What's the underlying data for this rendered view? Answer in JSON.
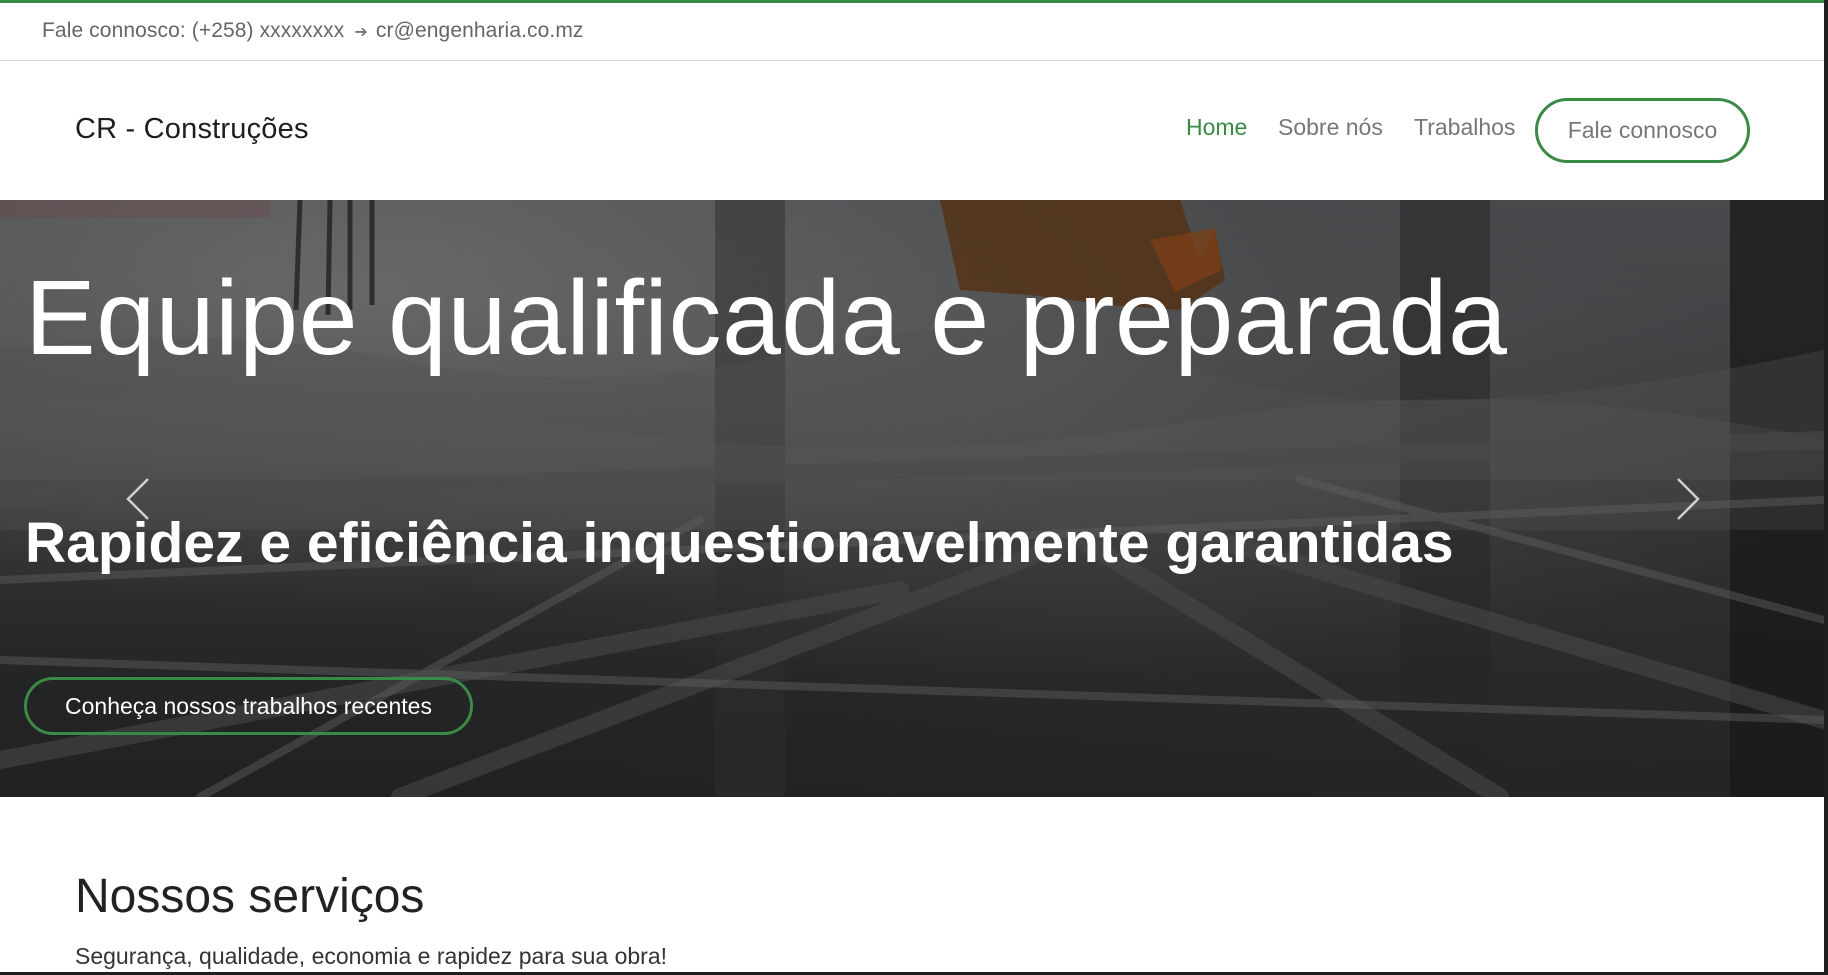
{
  "colors": {
    "accent": "#3a8a45",
    "link": "#777777",
    "text": "#222222"
  },
  "topbar": {
    "phone": "Fale connosco: (+258) xxxxxxxx",
    "separator_icon": "arrow-right-icon",
    "email": "cr@engenharia.co.mz"
  },
  "navbar": {
    "brand": "CR - Construções",
    "links": [
      {
        "label": "Home",
        "active": true
      },
      {
        "label": "Sobre nós",
        "active": false
      },
      {
        "label": "Trabalhos",
        "active": false
      }
    ],
    "cta": "Fale connosco"
  },
  "hero": {
    "title": "Equipe qualificada e preparada",
    "subtitle": "Rapidez e eficiência inquestionavelmente garantidas",
    "button": "Conheça nossos trabalhos recentes",
    "prev_icon": "chevron-left-icon",
    "next_icon": "chevron-right-icon"
  },
  "services": {
    "title": "Nossos serviços",
    "subtitle": "Segurança, qualidade, economia e rapidez para sua obra!"
  }
}
